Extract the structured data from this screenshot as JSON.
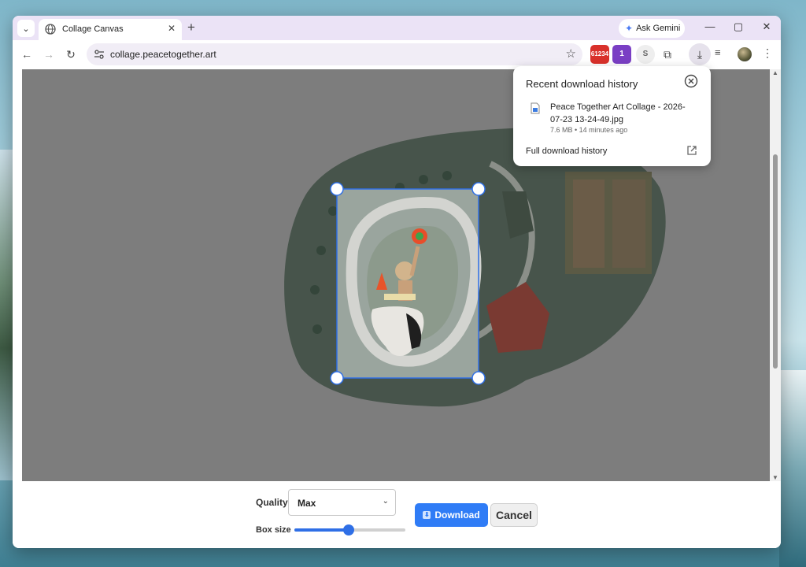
{
  "desktop": {},
  "browser": {
    "tab": {
      "title": "Collage Canvas"
    },
    "gemini": {
      "label": "Ask Gemini"
    },
    "toolbar": {
      "url": "collage.peacetogether.art",
      "ext_red_badge": "61234",
      "ext_purple_badge": "1",
      "ext_s_label": "S"
    }
  },
  "download_popup": {
    "title": "Recent download history",
    "file_name": "Peace Together Art Collage - 2026-07-23 13-24-49.jpg",
    "file_meta": "7.6 MB • 14 minutes ago",
    "full_history_label": "Full download history"
  },
  "controls": {
    "quality_label": "Quality",
    "quality_value": "Max",
    "box_size_label": "Box size",
    "box_size_level": 0.49,
    "download_label": "Download",
    "cancel_label": "Cancel"
  },
  "colors": {
    "accent": "#2f7cf6",
    "tabbar": "#ebe3f6",
    "canvas_bg": "#7d7d7d"
  }
}
